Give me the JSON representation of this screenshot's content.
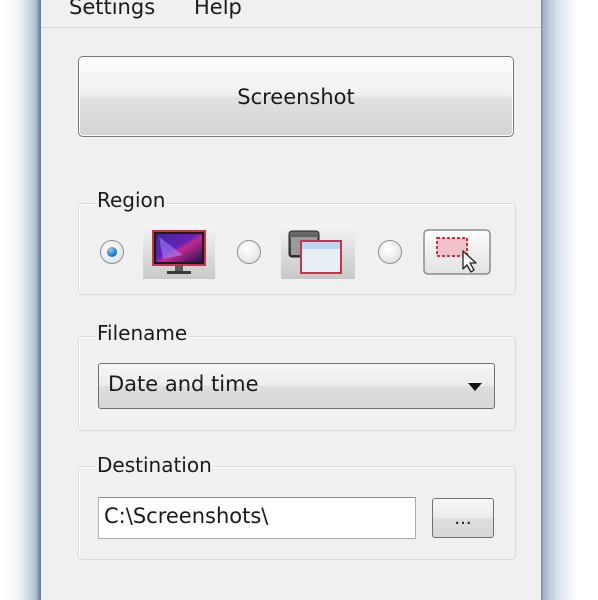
{
  "menubar": {
    "settings": "Settings",
    "help": "Help"
  },
  "screenshot_button": {
    "label": "Screenshot"
  },
  "region": {
    "label": "Region",
    "options": [
      {
        "icon": "full-screen-icon",
        "checked": true
      },
      {
        "icon": "window-icon",
        "checked": false
      },
      {
        "icon": "selection-area-icon",
        "checked": false
      }
    ]
  },
  "filename": {
    "label": "Filename",
    "selected": "Date and time"
  },
  "destination": {
    "label": "Destination",
    "path": "C:\\Screenshots\\",
    "browse_label": "..."
  },
  "colors": {
    "radio_selected": "#2a7fc6",
    "frame": "#6f8194",
    "selection_red": "#c8324b"
  }
}
